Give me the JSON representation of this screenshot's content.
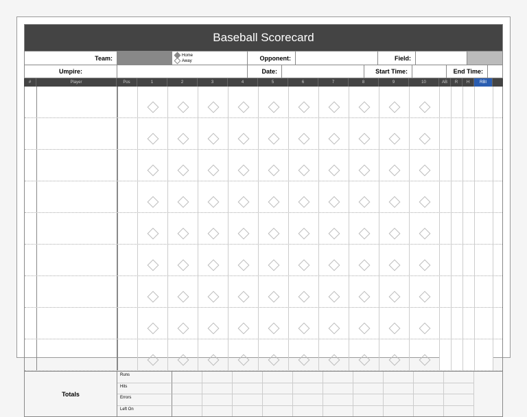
{
  "title": "Baseball Scorecard",
  "labels": {
    "team": "Team:",
    "opponent": "Opponent:",
    "field": "Field:",
    "umpire": "Umpire:",
    "date": "Date:",
    "start": "Start Time:",
    "end": "End Time:"
  },
  "legend": {
    "home": "Home",
    "away": "Away"
  },
  "headers": {
    "num": "#",
    "player": "Player",
    "pos": "Pos",
    "innings": [
      "1",
      "2",
      "3",
      "4",
      "5",
      "6",
      "7",
      "8",
      "9",
      "10"
    ],
    "stats": [
      "AB",
      "R",
      "H"
    ],
    "rbi": "RBI"
  },
  "totals": {
    "label": "Totals",
    "cats": [
      "Runs",
      "Hits",
      "Errors",
      "Left On"
    ]
  }
}
